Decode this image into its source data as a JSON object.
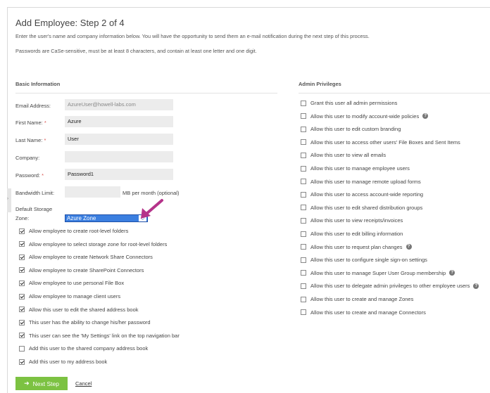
{
  "page": {
    "title": "Add Employee: Step 2 of 4",
    "intro": "Enter the user's name and company information below. You will have the opportunity to send them an e-mail notification during the next step of this process.",
    "password_rules": "Passwords are CaSe-sensitive, must be at least 8 characters, and contain at least one letter and one digit."
  },
  "basic": {
    "heading": "Basic Information",
    "email_label": "Email Address:",
    "email_value": "AzureUser@howell-labs.com",
    "first_label": "First Name:",
    "first_value": "Azure",
    "last_label": "Last Name:",
    "last_value": "User",
    "company_label": "Company:",
    "company_value": "",
    "password_label": "Password:",
    "password_value": "Password1",
    "required_mark": "*",
    "bandwidth_label": "Bandwidth Limit:",
    "bandwidth_value": "",
    "bandwidth_unit": "MB per month (optional)",
    "zone_label_1": "Default Storage",
    "zone_label_2": "Zone:",
    "zone_selected": "Azure Zone"
  },
  "options": [
    {
      "label": "Allow employee to create root-level folders",
      "checked": true
    },
    {
      "label": "Allow employee to select storage zone for root-level folders",
      "checked": true
    },
    {
      "label": "Allow employee to create Network Share Connectors",
      "checked": true
    },
    {
      "label": "Allow employee to create SharePoint Connectors",
      "checked": true
    },
    {
      "label": "Allow employee to use personal File Box",
      "checked": true
    },
    {
      "label": "Allow employee to manage client users",
      "checked": true
    },
    {
      "label": "Allow this user to edit the shared address book",
      "checked": true
    },
    {
      "label": "This user has the ability to change his/her password",
      "checked": true
    },
    {
      "label": "This user can see the 'My Settings' link on the top navigation bar",
      "checked": true
    },
    {
      "label": "Add this user to the shared company address book",
      "checked": false
    },
    {
      "label": "Add this user to my address book",
      "checked": true
    }
  ],
  "admin": {
    "heading": "Admin Privileges",
    "items": [
      {
        "label": "Grant this user all admin permissions",
        "checked": false,
        "help": false
      },
      {
        "label": "Allow this user to modify account-wide policies",
        "checked": false,
        "help": true
      },
      {
        "label": "Allow this user to edit custom branding",
        "checked": false,
        "help": false
      },
      {
        "label": "Allow this user to access other users' File Boxes and Sent Items",
        "checked": false,
        "help": false
      },
      {
        "label": "Allow this user to view all emails",
        "checked": false,
        "help": false
      },
      {
        "label": "Allow this user to manage employee users",
        "checked": false,
        "help": false
      },
      {
        "label": "Allow this user to manage remote upload forms",
        "checked": false,
        "help": false
      },
      {
        "label": "Allow this user to access account-wide reporting",
        "checked": false,
        "help": false
      },
      {
        "label": "Allow this user to edit shared distribution groups",
        "checked": false,
        "help": false
      },
      {
        "label": "Allow this user to view receipts/invoices",
        "checked": false,
        "help": false
      },
      {
        "label": "Allow this user to edit billing information",
        "checked": false,
        "help": false
      },
      {
        "label": "Allow this user to request plan changes",
        "checked": false,
        "help": true
      },
      {
        "label": "Allow this user to configure single sign-on settings",
        "checked": false,
        "help": false
      },
      {
        "label": "Allow this user to manage Super User Group membership",
        "checked": false,
        "help": true
      },
      {
        "label": "Allow this user to delegate admin privileges to other employee users",
        "checked": false,
        "help": true
      },
      {
        "label": "Allow this user to create and manage Zones",
        "checked": false,
        "help": false
      },
      {
        "label": "Allow this user to create and manage Connectors",
        "checked": false,
        "help": false
      }
    ]
  },
  "actions": {
    "next_label": "Next Step",
    "next_icon": "arrow-right-icon",
    "cancel_label": "Cancel"
  },
  "colors": {
    "next_button": "#7cc242",
    "select_bg": "#3b7fe0",
    "annotation_arrow": "#b5338a"
  }
}
